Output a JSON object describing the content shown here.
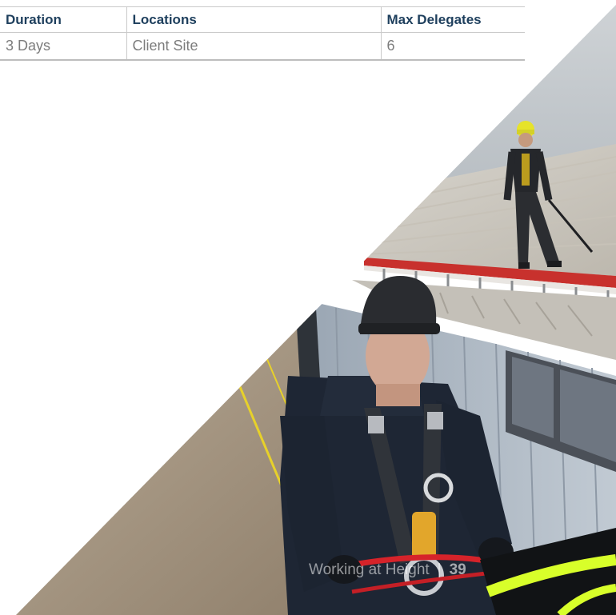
{
  "course_table": {
    "headers": [
      "Duration",
      "Locations",
      "Max Delegates"
    ],
    "row": [
      "3 Days",
      "Client Site",
      "6"
    ]
  },
  "footer": {
    "section": "Working at Height",
    "separator": "|",
    "page_number": "39"
  },
  "photo": {
    "subject": "photo-working-at-height"
  },
  "colors": {
    "header_text": "#1e3f5d",
    "cell_text": "#7c7c7c",
    "accent_yellow": "#e7d12a"
  }
}
